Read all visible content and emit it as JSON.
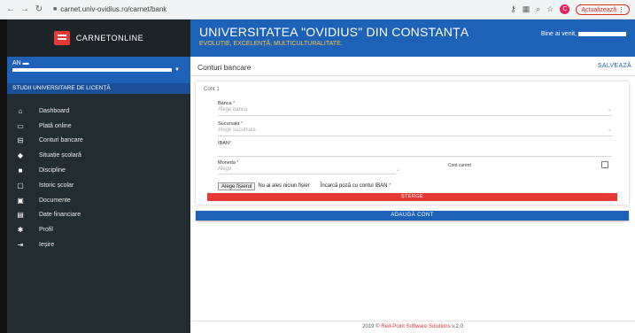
{
  "browser": {
    "url": "carnet.univ-ovidius.ro/carnet/bank",
    "profile_initial": "C",
    "update_label": "Actualizează"
  },
  "logo": {
    "text": "CARNETONLINE"
  },
  "sidebar": {
    "year_label": "AN",
    "program": "STUDII UNIVERSITARE DE LICENȚĂ",
    "items": [
      {
        "label": "Dashboard",
        "icon": "home-icon"
      },
      {
        "label": "Plată online",
        "icon": "credit-card-icon"
      },
      {
        "label": "Conturi bancare",
        "icon": "bank-icon"
      },
      {
        "label": "Situație școlară",
        "icon": "graduation-cap-icon"
      },
      {
        "label": "Discipline",
        "icon": "book-icon"
      },
      {
        "label": "Istoric școlar",
        "icon": "history-icon"
      },
      {
        "label": "Documente",
        "icon": "document-icon"
      },
      {
        "label": "Date financiare",
        "icon": "wallet-icon"
      },
      {
        "label": "Profil",
        "icon": "gear-icon"
      },
      {
        "label": "Ieșire",
        "icon": "logout-icon"
      }
    ]
  },
  "header": {
    "title": "UNIVERSITATEA \"OVIDIUS\" DIN CONSTANȚA",
    "subtitle": "EVOLUȚIE, EXCELENȚĂ, MULTICULTURALITATE.",
    "welcome": "Bine ai venit,"
  },
  "page": {
    "title": "Conturi bancare",
    "save_label": "SALVEAZĂ"
  },
  "account": {
    "title": "Cont 1",
    "bank_label": "Banca",
    "bank_placeholder": "Alege banca",
    "branch_label": "Sucursala",
    "branch_placeholder": "Alege sucursala",
    "iban_label": "IBAN",
    "currency_label": "Moneda",
    "currency_placeholder": "Alege",
    "current_account_label": "Cont curent",
    "file_button": "Alege fișierul",
    "file_none": "Nu ai ales niciun fișier",
    "upload_label": "Încarcă poză cu contul IBAN",
    "delete_label": "ȘTERGE",
    "required_mark": "*"
  },
  "add_account_label": "ADAUGĂ CONT",
  "footer": {
    "prefix": "2019 ©",
    "company": "Red-Point Software Solutions",
    "version": "v.2.0"
  }
}
